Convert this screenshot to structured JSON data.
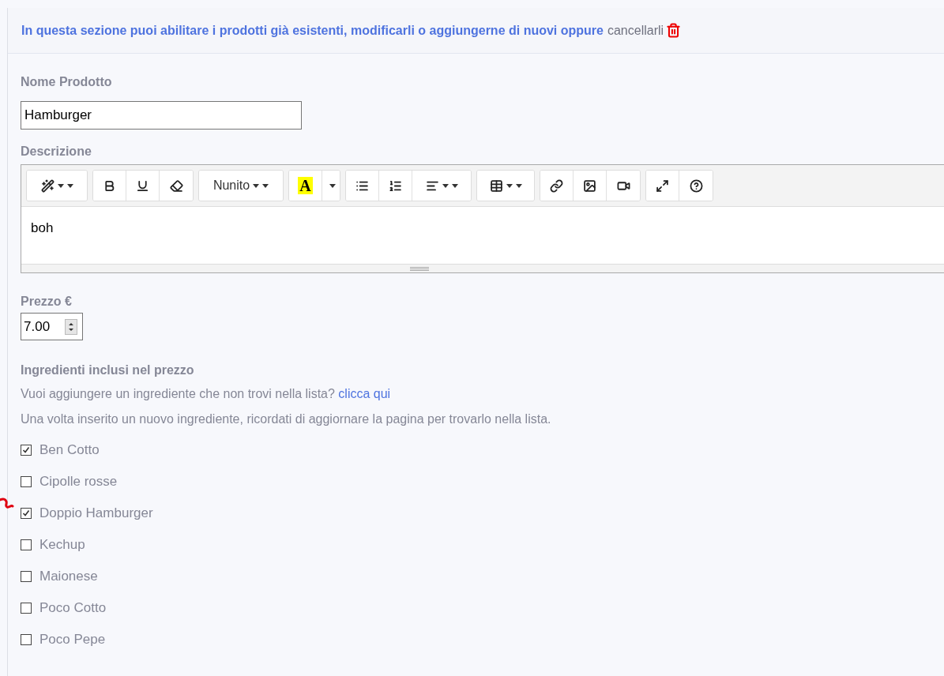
{
  "notice": {
    "text": "In questa sezione puoi abilitare i prodotti già esistenti, modificarli o aggiungerne di nuovi oppure",
    "link": "cancellarli"
  },
  "name_field": {
    "label": "Nome Prodotto",
    "value": "Hamburger"
  },
  "description": {
    "label": "Descrizione",
    "font": "Nunito",
    "color_letter": "A",
    "content": "boh"
  },
  "price_field": {
    "label": "Prezzo €",
    "value": "7.00"
  },
  "ingredients": {
    "title": "Ingredienti inclusi nel prezzo",
    "hint": "Vuoi aggiungere un ingrediente che non trovi nella lista?",
    "link": "clicca qui",
    "note": "Una volta inserito un nuovo ingrediente, ricordati di aggiornare la pagina per trovarlo nella lista.",
    "items": [
      {
        "label": "Ben Cotto",
        "checked": true
      },
      {
        "label": "Cipolle rosse",
        "checked": false
      },
      {
        "label": "Doppio Hamburger",
        "checked": true
      },
      {
        "label": "Kechup",
        "checked": false
      },
      {
        "label": "Maionese",
        "checked": false
      },
      {
        "label": "Poco Cotto",
        "checked": false
      },
      {
        "label": "Poco Pepe",
        "checked": false
      }
    ]
  }
}
